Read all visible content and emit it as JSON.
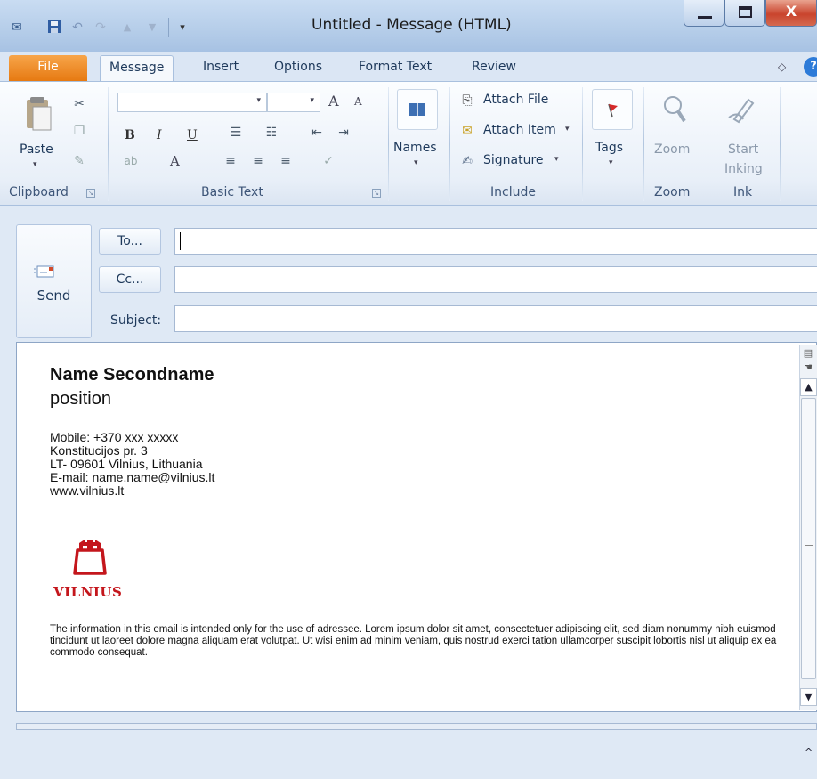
{
  "window": {
    "title": "Untitled  -  Message (HTML)",
    "close_glyph": "X",
    "min_glyph": "—",
    "max_glyph": "□"
  },
  "tabs": [
    "File",
    "Message",
    "Insert",
    "Options",
    "Format Text",
    "Review"
  ],
  "ribbon": {
    "clipboard": {
      "paste": "Paste",
      "group": "Clipboard"
    },
    "basic_text": {
      "group": "Basic Text",
      "bold": "B",
      "italic": "I",
      "underline": "U",
      "grow": "A",
      "shrink": "A",
      "font_color": "A"
    },
    "names": {
      "label": "Names"
    },
    "include": {
      "attach_file": "Attach File",
      "attach_item": "Attach Item",
      "signature": "Signature",
      "group": "Include"
    },
    "tags": {
      "label": "Tags"
    },
    "zoom": {
      "label": "Zoom",
      "group": "Zoom"
    },
    "ink": {
      "label_1": "Start",
      "label_2": "Inking",
      "group": "Ink"
    }
  },
  "header": {
    "send": "Send",
    "to_button": "To...",
    "cc_button": "Cc...",
    "subject_label": "Subject:",
    "to_value": "",
    "cc_value": "",
    "subject_value": ""
  },
  "signature": {
    "name": "Name Secondname",
    "position": "position",
    "mobile": "Mobile: +370 xxx xxxxx",
    "address_1": "Konstitucijos pr. 3",
    "address_2": "LT- 09601 Vilnius, Lithuania",
    "email": "E-mail: name.name@vilnius.lt",
    "web": "www.vilnius.lt",
    "logo_text": "VILNIUS",
    "disclaimer": "The information in this email is intended only for the use of adressee. Lorem ipsum dolor sit amet, consectetuer adipiscing elit, sed diam nonummy nibh euismod tincidunt ut laoreet dolore magna aliquam erat volutpat. Ut wisi enim ad minim veniam, quis nostrud exerci tation ullamcorper suscipit lobortis nisl ut aliquip ex ea commodo consequat."
  },
  "colors": {
    "file_tab": "#e6780f",
    "brand_red": "#c4161c",
    "close_button": "#c9442d"
  }
}
